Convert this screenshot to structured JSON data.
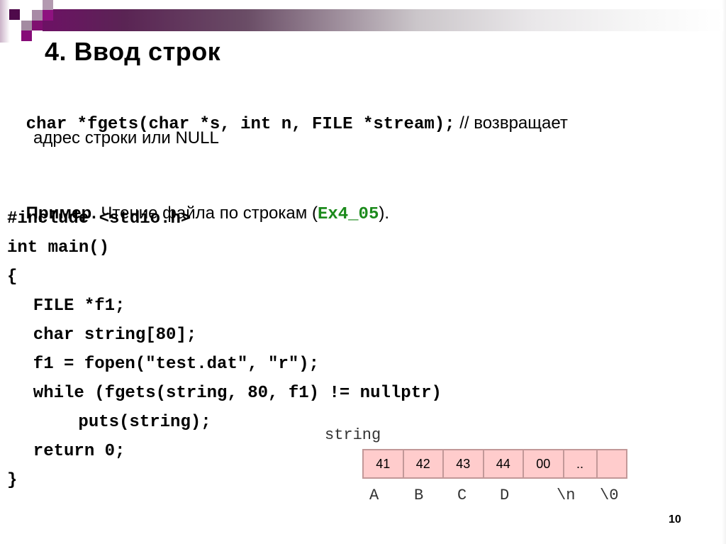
{
  "slide": {
    "title": "4. Ввод строк",
    "page_number": "10",
    "prototype": {
      "code": "char *fgets(char *s, int n, FILE *stream);",
      "comment": " // возвращает",
      "continuation": "адрес строки или NULL"
    },
    "example": {
      "label": "Пример.",
      "text": " Чтение файла по строкам (",
      "file_ref": "Ex4_05",
      "text_end": ")."
    },
    "code_lines": [
      "#include <stdio.h>",
      "int main()",
      "{",
      "  FILE *f1;",
      "  char string[80];",
      "  f1 = fopen(\"test.dat\", \"r\");",
      "  while (fgets(string, 80, f1) != nullptr)",
      "      puts(string);",
      "  return 0;",
      "}"
    ],
    "diagram": {
      "label": "string",
      "cells": [
        "41",
        "42",
        "43",
        "44",
        "00",
        "..",
        ""
      ],
      "chars": [
        "A",
        "B",
        "C",
        "D",
        "\\n",
        "\\0"
      ],
      "cell_color": "#ffcccc",
      "border_color": "#c29898"
    },
    "colors": {
      "accent_purple": "#6d1165",
      "file_ref_green": "#1b8a1b"
    }
  }
}
